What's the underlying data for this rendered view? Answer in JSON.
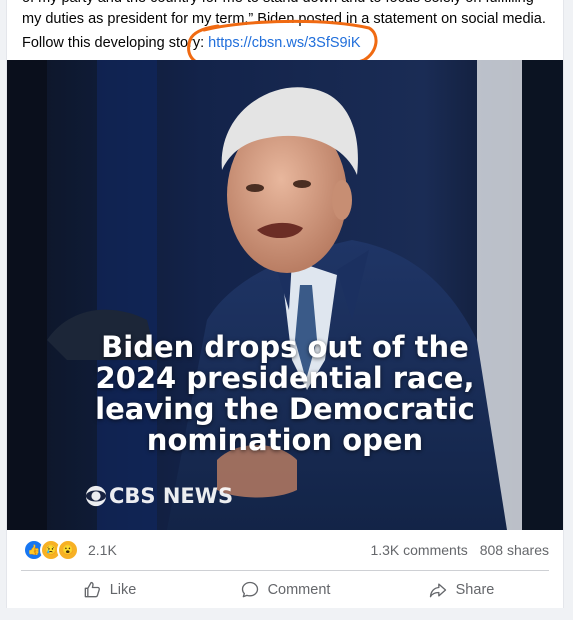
{
  "post": {
    "line1": "of my party and the country for me to stand down and to focus solely on fulfilling",
    "line2": "my duties as president for my term,” Biden posted in a statement on social media.",
    "line3_prefix": "Follow this developing story: ",
    "link_text": "https://cbsn.ws/3SfS9iK"
  },
  "media": {
    "headline": [
      "Biden drops out of the",
      "2024 presidential race,",
      "leaving the Democratic",
      "nomination open"
    ],
    "logo_text": "CBS NEWS"
  },
  "stats": {
    "reactions_count": "2.1K",
    "comments": "1.3K comments",
    "shares": "808 shares"
  },
  "actions": {
    "like": "Like",
    "comment": "Comment",
    "share": "Share"
  },
  "colors": {
    "link": "#216fdb",
    "annotation": "#f06a12",
    "background": "#f0f2f5"
  }
}
